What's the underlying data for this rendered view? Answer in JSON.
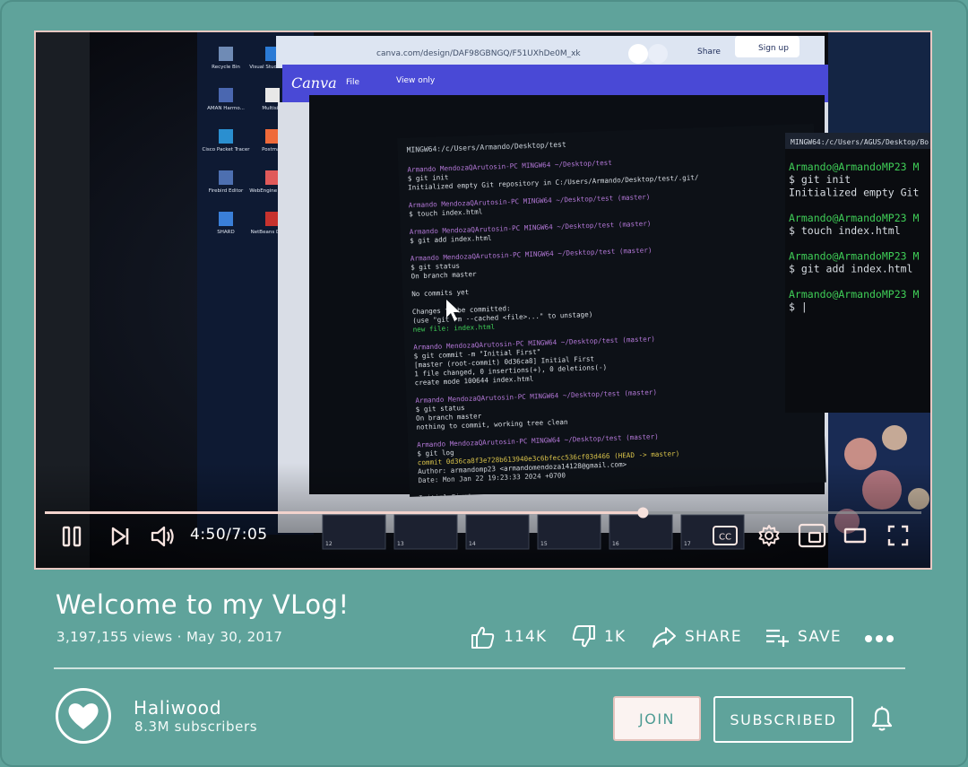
{
  "player": {
    "time_display": "4:50/7:05",
    "progress_fraction": 0.6824,
    "icons": [
      "pause-icon",
      "next-icon",
      "volume-icon",
      "cc-icon",
      "settings-icon",
      "miniplayer-icon",
      "theater-icon",
      "fullscreen-icon"
    ],
    "screen_content": {
      "browser_url": "canva.com/design/DAF98GBNGQ/F51UXhDe0M_xk",
      "canva_logo": "Canva",
      "canva_menu_file": "File",
      "canva_view_only": "View only",
      "share_label": "Share",
      "signup_label": "Sign up",
      "terminal_title": "MINGW64:/c/Users/Armando/Desktop/test",
      "terminal_lines": [
        {
          "t": "Armando MendozaQArutosin-PC MINGW64 ~/Desktop/test",
          "c": "p"
        },
        {
          "t": "$ git init",
          "c": "w"
        },
        {
          "t": "Initialized empty Git repository in C:/Users/Armando/Desktop/test/.git/",
          "c": "w"
        },
        {
          "t": "",
          "c": "w"
        },
        {
          "t": "Armando MendozaQArutosin-PC MINGW64 ~/Desktop/test (master)",
          "c": "p"
        },
        {
          "t": "$ touch index.html",
          "c": "w"
        },
        {
          "t": "",
          "c": "w"
        },
        {
          "t": "Armando MendozaQArutosin-PC MINGW64 ~/Desktop/test (master)",
          "c": "p"
        },
        {
          "t": "$ git add index.html",
          "c": "w"
        },
        {
          "t": "",
          "c": "w"
        },
        {
          "t": "Armando MendozaQArutosin-PC MINGW64 ~/Desktop/test (master)",
          "c": "p"
        },
        {
          "t": "$ git status",
          "c": "w"
        },
        {
          "t": "On branch master",
          "c": "w"
        },
        {
          "t": "",
          "c": "w"
        },
        {
          "t": "No commits yet",
          "c": "w"
        },
        {
          "t": "",
          "c": "w"
        },
        {
          "t": "Changes to be committed:",
          "c": "w"
        },
        {
          "t": "  (use \"git rm --cached <file>...\" to unstage)",
          "c": "w"
        },
        {
          "t": "        new file:   index.html",
          "c": "g"
        },
        {
          "t": "",
          "c": "w"
        },
        {
          "t": "Armando MendozaQArutosin-PC MINGW64 ~/Desktop/test (master)",
          "c": "p"
        },
        {
          "t": "$ git commit -m \"Initial First\"",
          "c": "w"
        },
        {
          "t": "[master (root-commit) 0d36ca8] Initial First",
          "c": "w"
        },
        {
          "t": " 1 file changed, 0 insertions(+), 0 deletions(-)",
          "c": "w"
        },
        {
          "t": " create mode 100644 index.html",
          "c": "w"
        },
        {
          "t": "",
          "c": "w"
        },
        {
          "t": "Armando MendozaQArutosin-PC MINGW64 ~/Desktop/test (master)",
          "c": "p"
        },
        {
          "t": "$ git status",
          "c": "w"
        },
        {
          "t": "On branch master",
          "c": "w"
        },
        {
          "t": "nothing to commit, working tree clean",
          "c": "w"
        },
        {
          "t": "",
          "c": "w"
        },
        {
          "t": "Armando MendozaQArutosin-PC MINGW64 ~/Desktop/test (master)",
          "c": "p"
        },
        {
          "t": "$ git log",
          "c": "w"
        },
        {
          "t": "commit 0d36ca8f3e728b613940e3c6bfecc536cf03d466 (HEAD -> master)",
          "c": "y"
        },
        {
          "t": "Author: armandomp23 <armandomendoza14128@gmail.com>",
          "c": "w"
        },
        {
          "t": "Date:   Mon Jan 22 19:23:33 2024 +0700",
          "c": "w"
        },
        {
          "t": "",
          "c": "w"
        },
        {
          "t": "    Initial First",
          "c": "w"
        }
      ],
      "second_terminal_title": "MINGW64:/c/Users/AGUS/Desktop/Bo",
      "second_terminal_lines": [
        {
          "t": "Armando@ArmandoMP23 M",
          "c": "g"
        },
        {
          "t": "$ git init",
          "c": "w"
        },
        {
          "t": "Initialized empty Git",
          "c": "w"
        },
        {
          "t": "",
          "c": "w"
        },
        {
          "t": "Armando@ArmandoMP23 M",
          "c": "g"
        },
        {
          "t": "$ touch index.html",
          "c": "w"
        },
        {
          "t": "",
          "c": "w"
        },
        {
          "t": "Armando@ArmandoMP23 M",
          "c": "g"
        },
        {
          "t": "$ git add index.html",
          "c": "w"
        },
        {
          "t": "",
          "c": "w"
        },
        {
          "t": "Armando@ArmandoMP23 M",
          "c": "g"
        },
        {
          "t": "$ |",
          "c": "w"
        }
      ],
      "desktop_icons": [
        "Recycle Bin",
        "Visual Studio Code",
        "AMAN Harmo...",
        "Multisim",
        "Cisco Packet Tracer",
        "Postman",
        "Firebird Editor",
        "WebEngine Engine",
        "SHARD",
        "NetBeans Disable"
      ],
      "slide_numbers": [
        "12",
        "13",
        "14",
        "15",
        "16",
        "17"
      ]
    }
  },
  "video": {
    "title": "Welcome to my VLog!",
    "meta": "3,197,155 views · May 30, 2017"
  },
  "actions": {
    "like_count": "114K",
    "dislike_count": "1K",
    "share_label": "SHARE",
    "save_label": "SAVE"
  },
  "channel": {
    "name": "Haliwood",
    "subscribers": "8.3M subscribers"
  },
  "buttons": {
    "join_label": "JOIN",
    "subscribed_label": "SUBSCRIBED"
  },
  "colors": {
    "background": "#5fa39b",
    "accent": "#e8c8c2",
    "progress_played": "#f3d3cd",
    "join_text": "#4d9b93"
  }
}
